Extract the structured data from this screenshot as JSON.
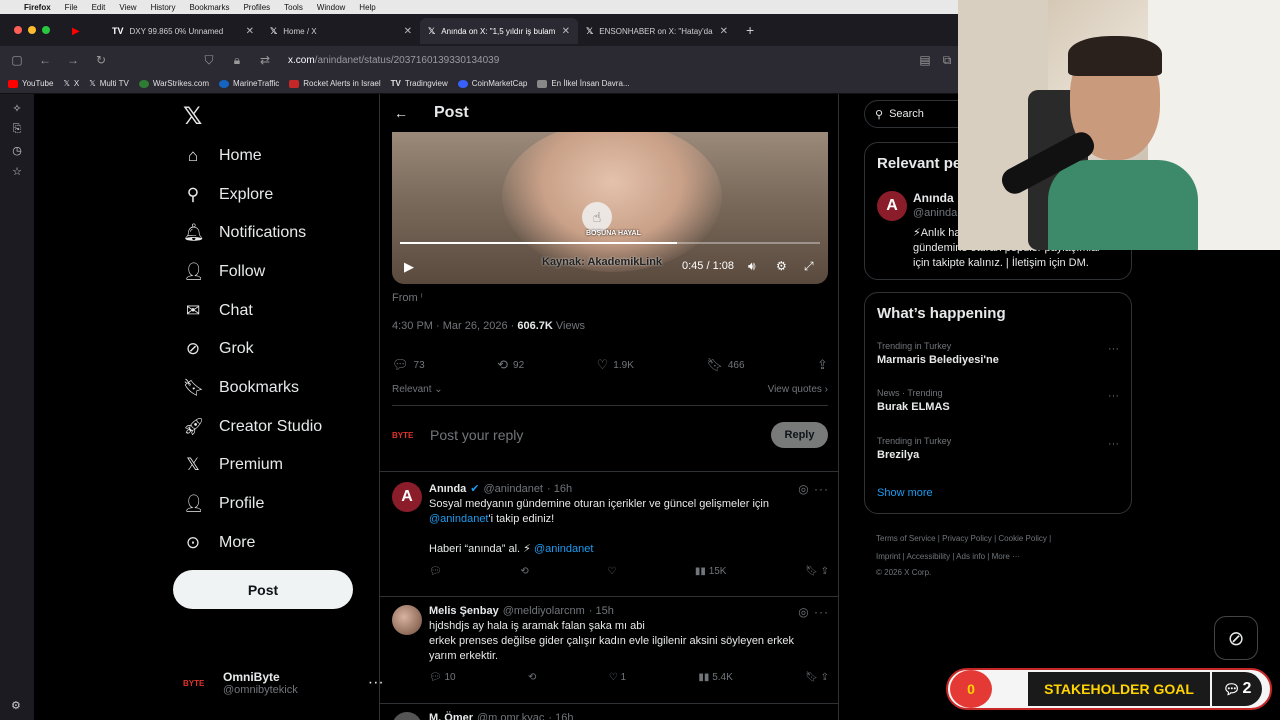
{
  "menubar": {
    "items": [
      "Firefox",
      "File",
      "Edit",
      "View",
      "History",
      "Bookmarks",
      "Profiles",
      "Tools",
      "Window",
      "Help"
    ]
  },
  "tabs": [
    {
      "label": "DXY 99.865 0% Unnamed"
    },
    {
      "label": "Home / X"
    },
    {
      "label": "Anında on X: \"1,5 yıldır iş bulam"
    },
    {
      "label": "ENSONHABER on X: \"Hatay'da"
    }
  ],
  "url": {
    "host": "x.com",
    "path": "/anindanet/status/2037160139330134039"
  },
  "bookmarks": [
    "YouTube",
    "X",
    "Multi TV",
    "WarStrikes.com",
    "MarineTraffic",
    "Rocket Alerts in Israel",
    "Tradingview",
    "CoinMarketCap",
    "En İlkel İnsan Davra..."
  ],
  "nav": {
    "home": "Home",
    "explore": "Explore",
    "notifications": "Notifications",
    "follow": "Follow",
    "chat": "Chat",
    "grok": "Grok",
    "bookmarks": "Bookmarks",
    "creator": "Creator Studio",
    "premium": "Premium",
    "profile": "Profile",
    "more": "More",
    "post": "Post"
  },
  "account": {
    "name": "OmniByte",
    "handle": "@omnibytekick",
    "avatar_text": "BYTE"
  },
  "post": {
    "header": "Post",
    "video_overlay": "BOŞUNA HAYAL",
    "video_source": "Kaynak: AkademikLink",
    "video_time": "0:45 / 1:08",
    "video_progress": 0.66,
    "from": "From",
    "time": "4:30 PM · Mar 26, 2026 · ",
    "views": "606.7K",
    "views_label": " Views",
    "replies": "73",
    "reposts": "92",
    "likes": "1.9K",
    "bookmarks": "466",
    "relevant": "Relevant",
    "view_quotes": "View quotes",
    "reply_placeholder": "Post your reply",
    "reply_button": "Reply"
  },
  "replies": [
    {
      "name": "Anında",
      "handle": "@anindanet",
      "time": "· 16h",
      "line1": "Sosyal medyanın gündemine oturan içerikler ve güncel gelişmeler için",
      "mention": "@anindanet",
      "line2": "'i takip ediniz!",
      "line3": "Haberi “anında” al. ⚡ ",
      "mention2": "@anindanet",
      "views": "15K"
    },
    {
      "name": "Melis Şenbay",
      "handle": "@meldiyolarcnm",
      "time": "· 15h",
      "text1": "hjdshdjs ay hala iş aramak falan şaka mı abi",
      "text2": "erkek prenses değilse gider çalışır kadın evle ilgilenir aksini söyleyen erkek",
      "text3": "yarım erkektir.",
      "replies": "10",
      "likes": "1",
      "views": "5.4K"
    },
    {
      "name": "M. Ömer",
      "handle": "@m.omr.kyac",
      "time": "· 16h"
    }
  ],
  "right": {
    "search": "Search",
    "relevant_title": "Relevant people",
    "rel_name": "Anında",
    "rel_handle": "@anindanet",
    "rel_bio1": "⚡Anlık haberler,",
    "rel_bio2": "gündemine oturan popüler paylaşımlar",
    "rel_bio3": "için takipte kalınız. | İletişim için DM.",
    "happening_title": "What’s happening",
    "trends": [
      {
        "context": "Trending in Turkey",
        "name": "Marmaris Belediyesi'ne"
      },
      {
        "context": "News · Trending",
        "name": "Burak ELMAS"
      },
      {
        "context": "Trending in Turkey",
        "name": "Brezilya"
      }
    ],
    "show_more": "Show more",
    "footer1": "Terms of Service  |  Privacy Policy  |  Cookie Policy  |",
    "footer2": "Imprint  |  Accessibility  |  Ads info  |  More ···",
    "footer3": "© 2026 X Corp."
  },
  "goal": {
    "count": "0",
    "label": "STAKEHOLDER GOAL",
    "comments": "2"
  },
  "colors": {
    "accent": "#1d9bf0",
    "bg": "#000000",
    "border": "#2f3336",
    "muted": "#71767b"
  }
}
